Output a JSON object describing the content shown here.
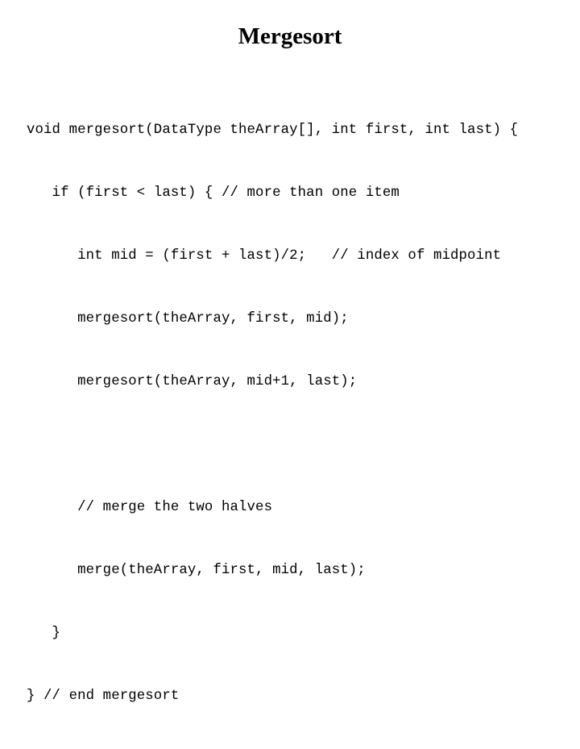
{
  "slide": {
    "title": "Mergesort",
    "background_color": "#ffffff",
    "text_color": "#000000"
  },
  "code": {
    "language": "cpp",
    "lines": [
      "void mergesort(DataType theArray[], int first, int last) {",
      "   if (first < last) { // more than one item",
      "      int mid = (first + last)/2;   // index of midpoint",
      "      mergesort(theArray, first, mid);",
      "      mergesort(theArray, mid+1, last);",
      "",
      "      // merge the two halves",
      "      merge(theArray, first, mid, last);",
      "   }",
      "} // end mergesort"
    ]
  }
}
